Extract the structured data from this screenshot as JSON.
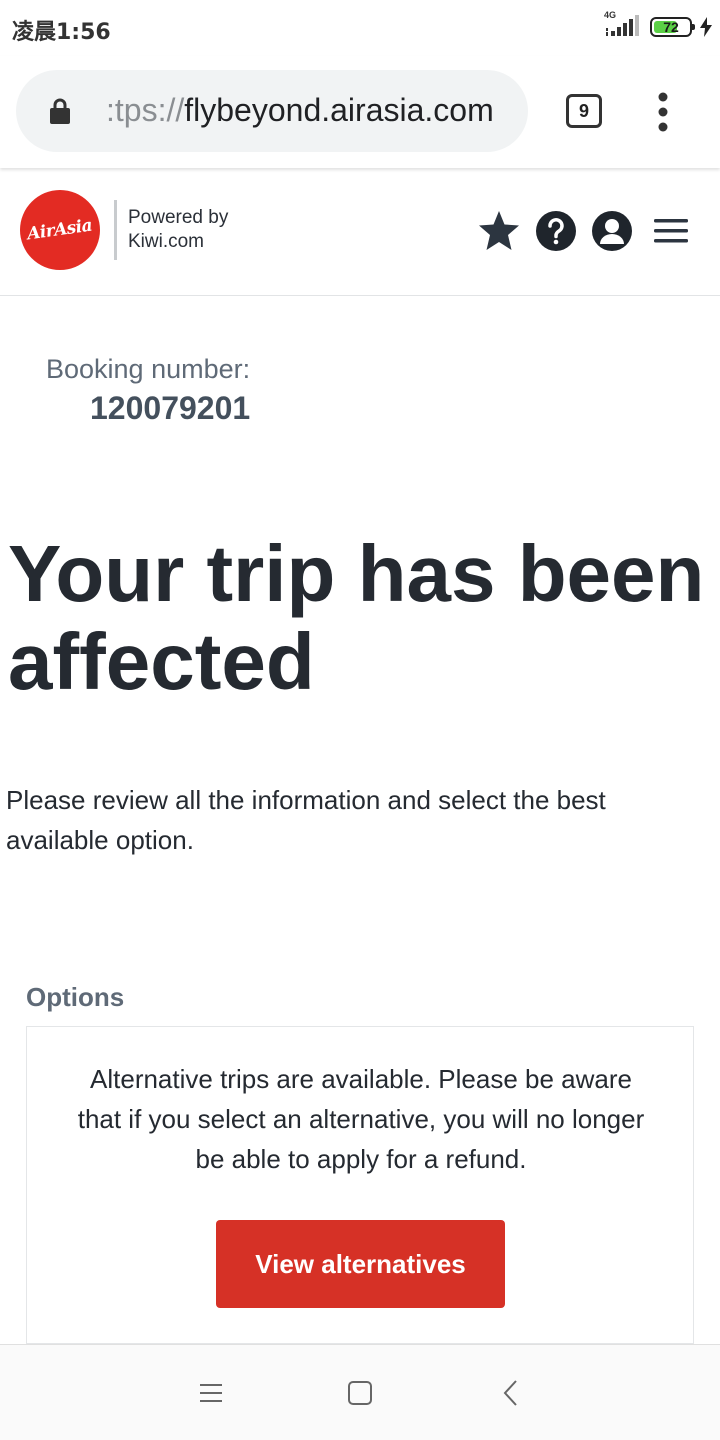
{
  "status_bar": {
    "time": "凌晨1:56",
    "network": "4G",
    "battery_level": "72",
    "battery_fraction": 0.72,
    "charging": true
  },
  "browser": {
    "url_scheme": ":tps://",
    "url_host": "flybeyond.airasia.com",
    "tab_count": "9"
  },
  "header": {
    "logo_text": "AirAsia",
    "powered_by_line1": "Powered by",
    "powered_by_line2": "Kiwi.com",
    "icons": [
      "star-icon",
      "help-icon",
      "user-icon",
      "hamburger-menu-icon"
    ]
  },
  "booking": {
    "label": "Booking number:",
    "number": "120079201"
  },
  "main": {
    "title": "Your trip has been affected",
    "intro": "Please review all the information and select the best available option."
  },
  "options": {
    "label": "Options",
    "message": "Alternative trips are available. Please be aware that if you select an alternative, you will no longer be able to apply for a refund.",
    "button_label": "View alternatives"
  },
  "colors": {
    "brand_red": "#e32b23",
    "button_red": "#d63126",
    "text_dark": "#252a31",
    "text_muted": "#5f6a77",
    "battery_green": "#5bd046"
  },
  "nav_bar": {
    "icons": [
      "recent-apps-icon",
      "home-icon",
      "back-icon"
    ]
  }
}
